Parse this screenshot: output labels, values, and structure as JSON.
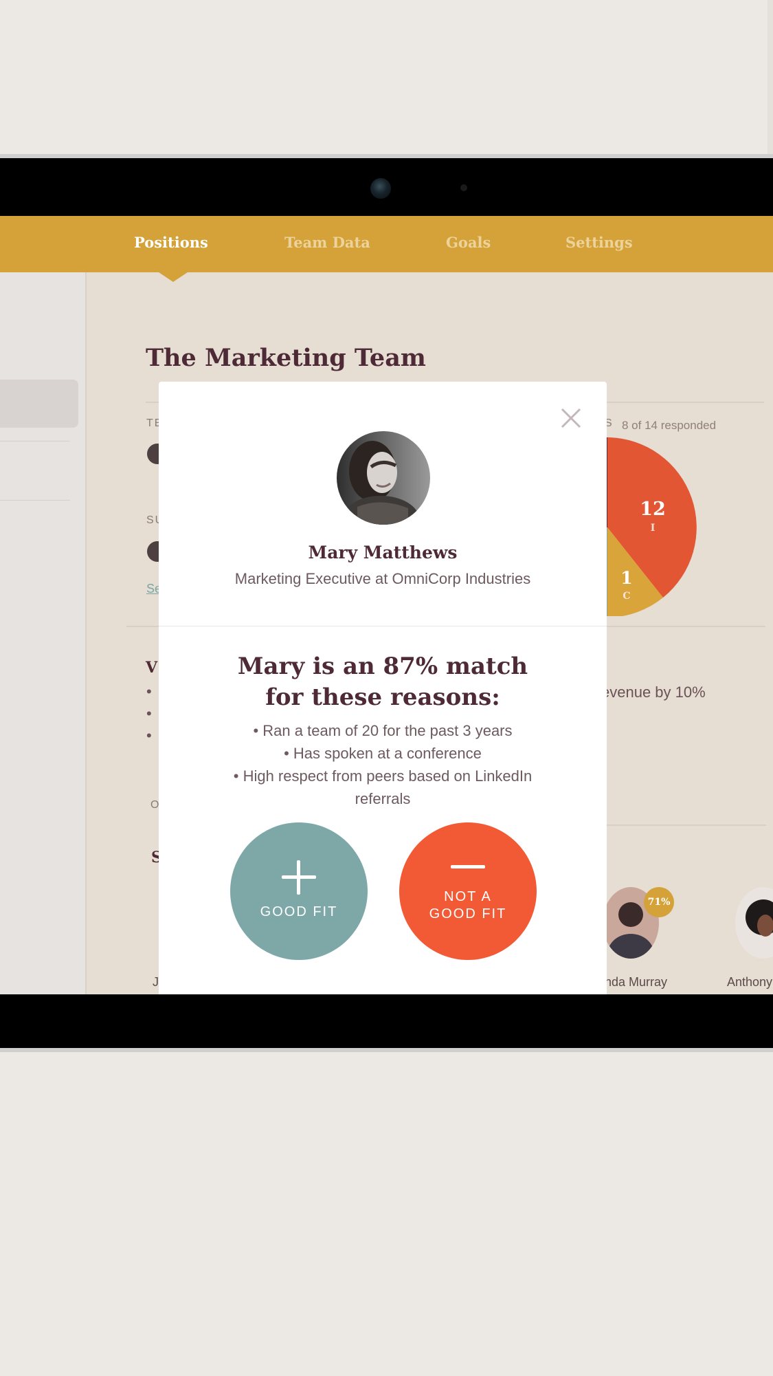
{
  "nav": {
    "items": [
      {
        "label": "Positions",
        "active": true
      },
      {
        "label": "Team Data",
        "active": false
      },
      {
        "label": "Goals",
        "active": false
      },
      {
        "label": "Settings",
        "active": false
      }
    ]
  },
  "background": {
    "team_title": "The Marketing Team",
    "responded": "8 of 14 responded",
    "section_label_1": "TE",
    "section_label_2": "SU",
    "section_label_3": "O",
    "link_fragment": "Se",
    "values_heading_fragment": "V",
    "goal_fragment": "evenue by 10%",
    "candidates_heading_fragment": "S",
    "candidates": [
      {
        "name": "nda Murray",
        "match": "71%"
      },
      {
        "name": "Anthony"
      }
    ],
    "name_fragment": "J"
  },
  "pie_chart": {
    "slices": [
      {
        "value": "12",
        "label": "I",
        "color": "#e25634"
      },
      {
        "value": "1",
        "label": "C",
        "color": "#d9a43a"
      }
    ]
  },
  "modal": {
    "name": "Mary Matthews",
    "role": "Marketing Executive at OmniCorp Industries",
    "match_line1": "Mary is an 87% match",
    "match_line2": "for these reasons:",
    "reasons": [
      "• Ran a team of 20 for the past 3 years",
      "• Has spoken at a conference",
      "• High respect from peers based on LinkedIn referrals"
    ],
    "good_fit_label": "GOOD FIT",
    "not_good_fit_line1": "NOT A",
    "not_good_fit_line2": "GOOD FIT"
  },
  "colors": {
    "nav_bg": "#d4a238",
    "good_fit": "#7ea8a8",
    "not_good_fit": "#f25a35",
    "heading": "#4d2a36"
  },
  "icons": [
    "close-icon",
    "plus-icon",
    "minus-icon",
    "camera-icon"
  ]
}
